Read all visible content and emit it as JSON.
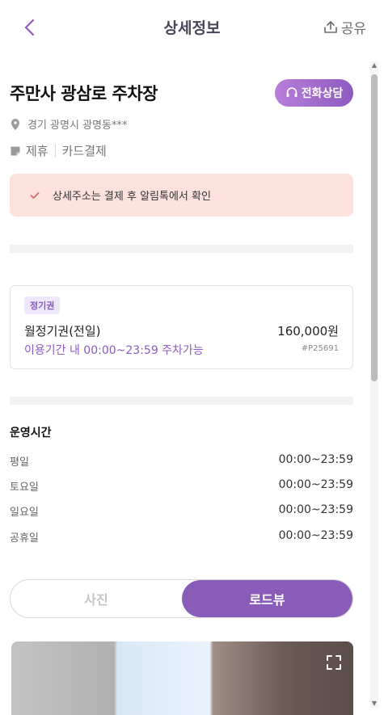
{
  "header": {
    "title": "상세정보",
    "share_label": "공유"
  },
  "place": {
    "name": "주만사 광삼로 주차장",
    "call_label": "전화상담",
    "address": "경기 광명시 광명동***",
    "tags": [
      "제휴",
      "카드결제"
    ]
  },
  "notice": {
    "text": "상세주소는 결제 후 알림톡에서 확인"
  },
  "ticket": {
    "badge": "정기권",
    "name": "월정기권(전일)",
    "price": "160,000원",
    "availability": "이용기간 내 00:00~23:59 주차가능",
    "code": "#P25691"
  },
  "hours": {
    "title": "운영시간",
    "rows": [
      {
        "day": "평일",
        "time": "00:00~23:59"
      },
      {
        "day": "토요일",
        "time": "00:00~23:59"
      },
      {
        "day": "일요일",
        "time": "00:00~23:59"
      },
      {
        "day": "공휴일",
        "time": "00:00~23:59"
      }
    ]
  },
  "view_toggle": {
    "options": [
      "사진",
      "로드뷰"
    ],
    "selected": "로드뷰"
  },
  "colors": {
    "accent": "#8a5cb9",
    "notice_bg": "#fde1dd",
    "badge_bg": "#efe7fb"
  }
}
